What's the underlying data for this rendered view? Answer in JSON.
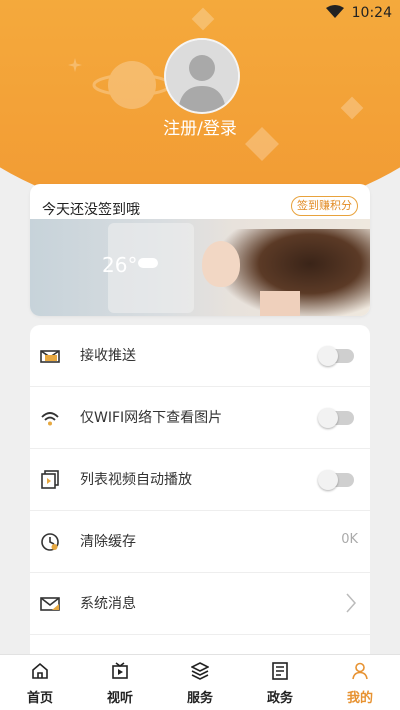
{
  "status_bar": {
    "time": "10:24",
    "wifi_icon": "wifi-icon"
  },
  "profile": {
    "avatar_icon": "avatar-icon",
    "login_text": "注册/登录"
  },
  "signin_card": {
    "title": "今天还没签到哦",
    "badge": "签到赚积分",
    "banner_temp": "26°"
  },
  "settings": [
    {
      "icon": "envelope-icon",
      "label": "接收推送",
      "control": "toggle",
      "on": false
    },
    {
      "icon": "wifi-icon",
      "label": "仅WIFI网络下查看图片",
      "control": "toggle",
      "on": false
    },
    {
      "icon": "play-list-icon",
      "label": "列表视频自动播放",
      "control": "toggle",
      "on": false
    },
    {
      "icon": "clock-icon",
      "label": "清除缓存",
      "control": "value",
      "value": "0K"
    },
    {
      "icon": "mail-icon",
      "label": "系统消息",
      "control": "chevron"
    },
    {
      "icon": "info-icon",
      "label": "",
      "control": "chevron"
    }
  ],
  "tabs": [
    {
      "label": "首页",
      "icon": "home-icon"
    },
    {
      "label": "视听",
      "icon": "video-icon"
    },
    {
      "label": "服务",
      "icon": "layers-icon"
    },
    {
      "label": "政务",
      "icon": "document-icon"
    },
    {
      "label": "我的",
      "icon": "person-icon",
      "active": true
    }
  ],
  "colors": {
    "accent": "#e79231",
    "header_orange": "#f4a93c"
  }
}
